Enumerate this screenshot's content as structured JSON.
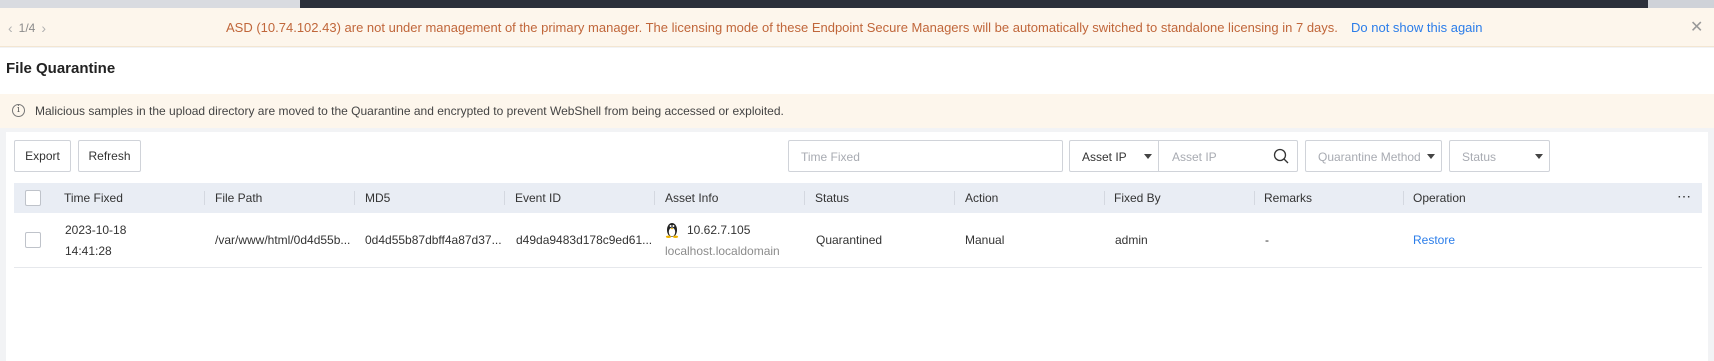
{
  "notice": {
    "pager": "1/4",
    "message": "ASD (10.74.102.43) are not under management of the primary manager. The licensing mode of these Endpoint Secure Managers will be automatically switched to standalone licensing in 7 days.",
    "dismiss_link": "Do not show this again"
  },
  "page": {
    "title": "File Quarantine",
    "info": "Malicious samples in the upload directory are moved to the Quarantine and encrypted to prevent WebShell from being accessed or exploited."
  },
  "toolbar": {
    "export_label": "Export",
    "refresh_label": "Refresh",
    "time_fixed_placeholder": "Time Fixed",
    "asset_ip_select": "Asset IP",
    "asset_ip_placeholder": "Asset IP",
    "quarantine_method_placeholder": "Quarantine Method",
    "status_placeholder": "Status"
  },
  "table": {
    "columns": [
      "Time Fixed",
      "File Path",
      "MD5",
      "Event ID",
      "Asset Info",
      "Status",
      "Action",
      "Fixed By",
      "Remarks",
      "Operation"
    ],
    "rows": [
      {
        "date": "2023-10-18",
        "time": "14:41:28",
        "file_path": "/var/www/html/0d4d55b...",
        "md5": "0d4d55b87dbff4a87d37...",
        "event_id": "d49da9483d178c9ed61...",
        "asset_ip": "10.62.7.105",
        "asset_host": "localhost.localdomain",
        "status": "Quarantined",
        "action": "Manual",
        "fixed_by": "admin",
        "remarks": "-",
        "operation": "Restore"
      }
    ]
  },
  "icons": {
    "prev": "chevron-left-icon",
    "next": "chevron-right-icon",
    "close": "close-icon",
    "info": "info-icon",
    "search": "search-icon",
    "linux": "linux-tux-icon",
    "more": "more-options-icon"
  },
  "colors": {
    "notice_text": "#c0663a",
    "link": "#2b7de9",
    "table_header": "#e9edf4"
  }
}
